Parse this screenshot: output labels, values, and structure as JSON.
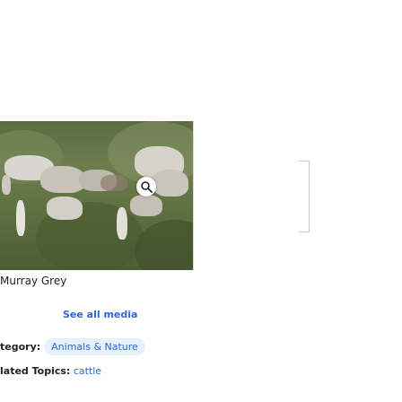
{
  "media": {
    "caption": "Murray Grey",
    "zoom_icon": "magnifier-icon"
  },
  "see_all": {
    "label": "See all media"
  },
  "category": {
    "label": "tegory:",
    "chip": "Animals & Nature"
  },
  "topics": {
    "label": "lated Topics:",
    "values": " cattle"
  },
  "colors": {
    "link": "#3366cc",
    "chip_bg": "#e4f2fe",
    "grass": "#5f7041"
  }
}
